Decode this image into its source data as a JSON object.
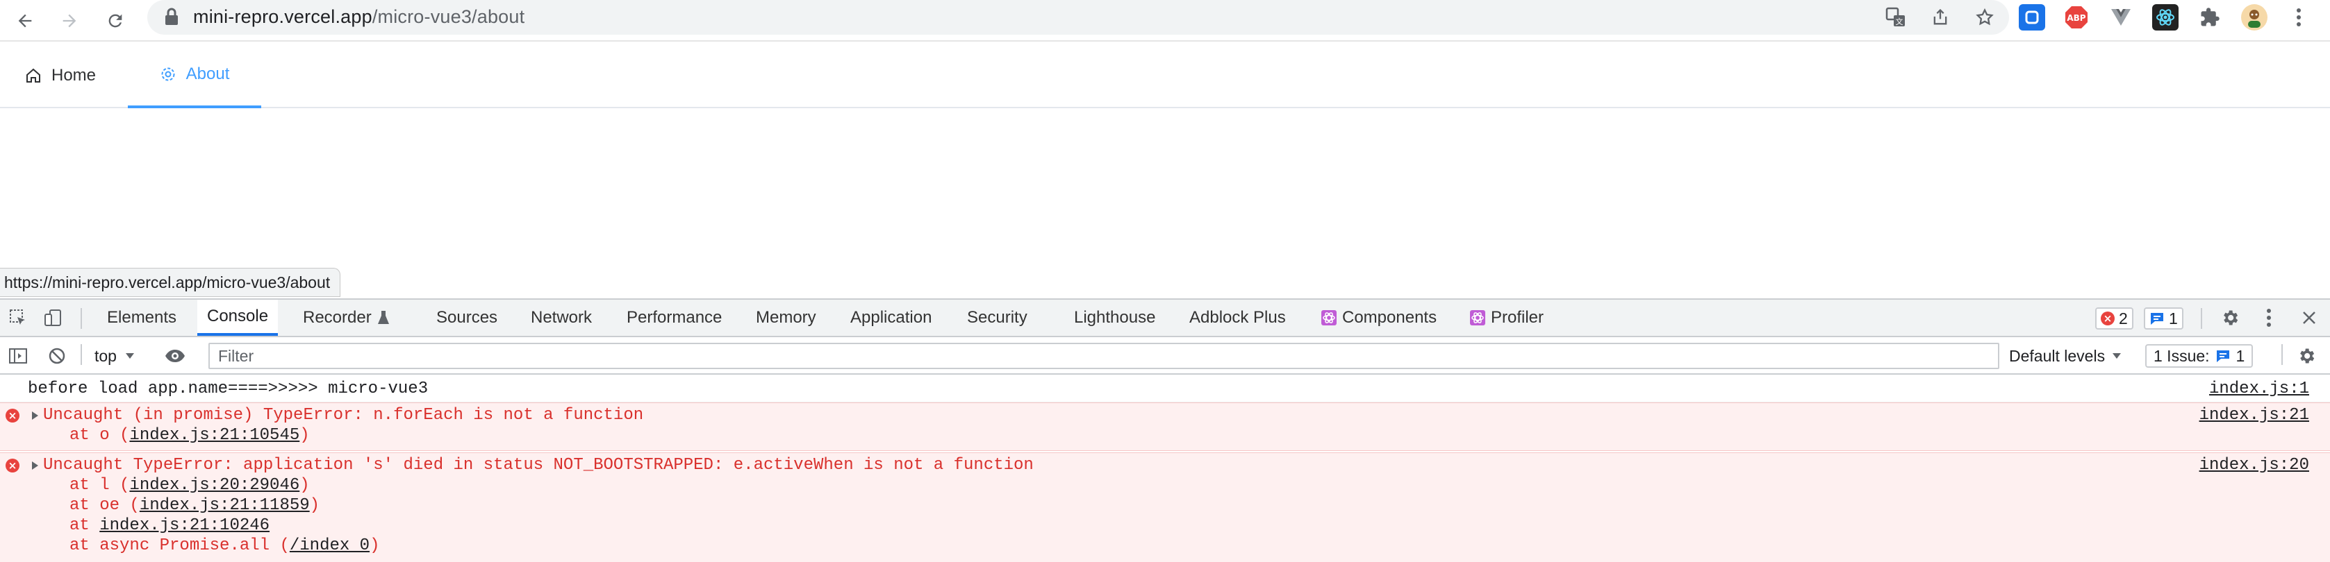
{
  "browser": {
    "url_host": "mini-repro.vercel.app",
    "url_path": "/micro-vue3/about"
  },
  "app_nav": {
    "tabs": [
      {
        "label": "Home",
        "icon": "home-icon"
      },
      {
        "label": "About",
        "icon": "gear-icon",
        "active": true
      }
    ],
    "accent_color": "#409eff"
  },
  "status_bar": {
    "hover_url": "https://mini-repro.vercel.app/micro-vue3/about"
  },
  "devtools": {
    "tabs": [
      "Elements",
      "Console",
      "Recorder",
      "Sources",
      "Network",
      "Performance",
      "Memory",
      "Application",
      "Security",
      "Lighthouse",
      "Adblock Plus",
      "Components",
      "Profiler"
    ],
    "active_tab": "Console",
    "error_count": "2",
    "message_count": "1",
    "toolbar": {
      "context": "top",
      "filter_placeholder": "Filter",
      "levels": "Default levels",
      "issues_label": "1 Issue:",
      "issues_count": "1"
    },
    "console": {
      "log": {
        "text": "before load app.name====>>>>> micro-vue3",
        "source": "index.js:1"
      },
      "error1": {
        "text": "Uncaught (in promise) TypeError: n.forEach is not a function",
        "source": "index.js:21",
        "trace": [
          {
            "prefix": "at o (",
            "link": "index.js:21:10545",
            "suffix": ")"
          }
        ]
      },
      "error2": {
        "text": "Uncaught TypeError: application 's' died in status NOT_BOOTSTRAPPED: e.activeWhen is not a function",
        "source": "index.js:20",
        "trace": [
          {
            "prefix": "at l (",
            "link": "index.js:20:29046",
            "suffix": ")"
          },
          {
            "prefix": "at oe (",
            "link": "index.js:21:11859",
            "suffix": ")"
          },
          {
            "prefix": "at ",
            "link": "index.js:21:10246",
            "suffix": ""
          },
          {
            "prefix": "at async Promise.all (",
            "link": "/index 0",
            "suffix": ")"
          }
        ]
      }
    }
  }
}
